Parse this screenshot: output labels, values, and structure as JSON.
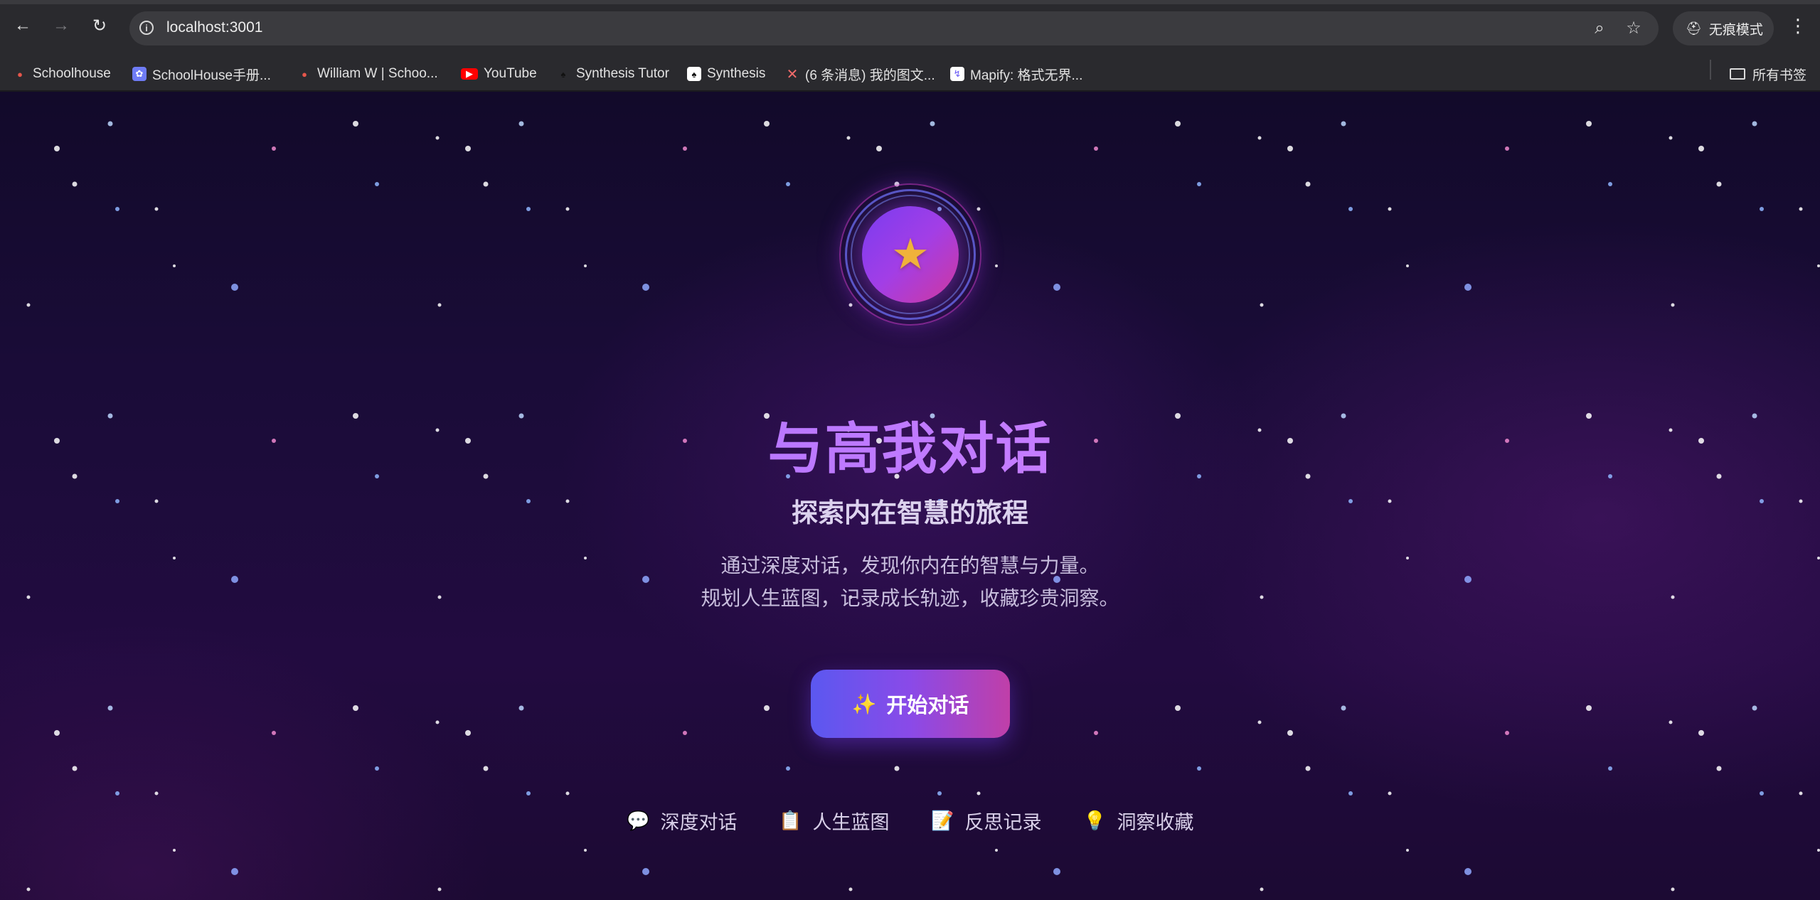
{
  "browser": {
    "url": "localhost:3001",
    "incognito_label": "无痕模式",
    "all_bookmarks_label": "所有书签",
    "bookmarks": [
      {
        "label": "Schoolhouse",
        "icon": "schoolhouse-icon",
        "color": "#e6564b"
      },
      {
        "label": "SchoolHouse手册...",
        "icon": "settings-icon",
        "color": "#6f7cf5"
      },
      {
        "label": "William W | Schoo...",
        "icon": "schoolhouse-icon",
        "color": "#e6564b"
      },
      {
        "label": "YouTube",
        "icon": "youtube-icon",
        "color": "#ff0000"
      },
      {
        "label": "Synthesis Tutor",
        "icon": "synthesis-icon",
        "color": "#111111"
      },
      {
        "label": "Synthesis",
        "icon": "synthesis-icon",
        "color": "#ffffff"
      },
      {
        "label": "(6 条消息) 我的图文...",
        "icon": "csdn-icon",
        "color": "#f55"
      },
      {
        "label": "Mapify: 格式无界...",
        "icon": "mapify-icon",
        "color": "#6a5cf5"
      }
    ]
  },
  "hero": {
    "title": "与高我对话",
    "subtitle": "探索内在智慧的旅程",
    "description_line1": "通过深度对话，发现你内在的智慧与力量。",
    "description_line2": "规划人生蓝图，记录成长轨迹，收藏珍贵洞察。",
    "cta_label": "开始对话",
    "cta_icon": "sparkles-icon",
    "logo_icon": "star-icon"
  },
  "features": [
    {
      "label": "深度对话",
      "icon": "speech-bubble-icon",
      "glyph": "💬"
    },
    {
      "label": "人生蓝图",
      "icon": "clipboard-icon",
      "glyph": "📋"
    },
    {
      "label": "反思记录",
      "icon": "memo-icon",
      "glyph": "📝"
    },
    {
      "label": "洞察收藏",
      "icon": "lightbulb-icon",
      "glyph": "💡"
    }
  ],
  "colors": {
    "background": "#1a0c38",
    "accent_gradient_start": "#5b58f0",
    "accent_gradient_end": "#c03fa8",
    "title_color": "#b07cff"
  }
}
